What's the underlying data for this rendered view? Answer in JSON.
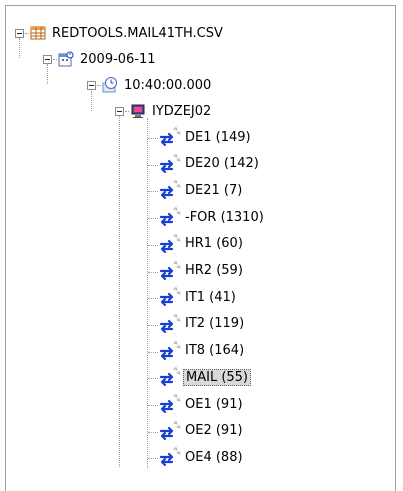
{
  "tree": {
    "root": {
      "label": "REDTOOLS.MAIL41TH.CSV",
      "icon": "table-icon"
    },
    "date": {
      "label": "2009-06-11",
      "icon": "calendar-icon"
    },
    "time": {
      "label": "10:40:00.000",
      "icon": "clock-icon"
    },
    "host": {
      "label": "IYDZEJ02",
      "icon": "computer-icon"
    },
    "leaves": [
      {
        "label": "DE1 (149)",
        "icon": "exchange-icon"
      },
      {
        "label": "DE20 (142)",
        "icon": "exchange-icon"
      },
      {
        "label": "DE21 (7)",
        "icon": "exchange-icon"
      },
      {
        "label": "-FOR (1310)",
        "icon": "exchange-icon"
      },
      {
        "label": "HR1 (60)",
        "icon": "exchange-icon"
      },
      {
        "label": "HR2 (59)",
        "icon": "exchange-icon"
      },
      {
        "label": "IT1 (41)",
        "icon": "exchange-icon"
      },
      {
        "label": "IT2 (119)",
        "icon": "exchange-icon"
      },
      {
        "label": "IT8 (164)",
        "icon": "exchange-icon"
      },
      {
        "label": "MAIL (55)",
        "icon": "exchange-icon",
        "selected": true
      },
      {
        "label": "OE1 (91)",
        "icon": "exchange-icon"
      },
      {
        "label": "OE2 (91)",
        "icon": "exchange-icon"
      },
      {
        "label": "OE4 (88)",
        "icon": "exchange-icon"
      }
    ]
  },
  "colors": {
    "selection": "#d9d9d9",
    "arrow_blue": "#1a3fd6",
    "tree_line": "#9a9a9a"
  }
}
